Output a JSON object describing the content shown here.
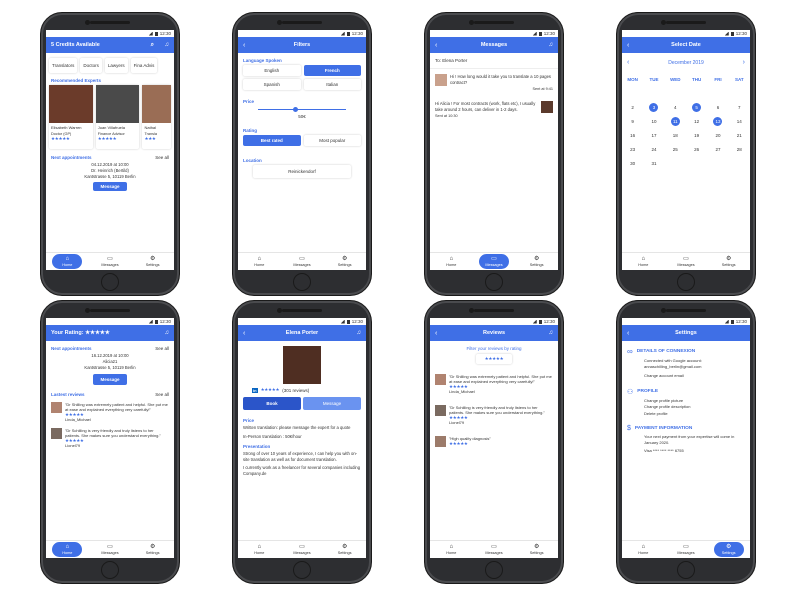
{
  "status": {
    "time": "12:30"
  },
  "tabbar": {
    "home": "Home",
    "messages": "Messages",
    "settings": "Settings"
  },
  "home": {
    "header": "5 Credits Available",
    "categories": [
      "Translators",
      "Doctors",
      "Lawyers",
      "Fina Advis"
    ],
    "recommended_title": "Recommended Experts",
    "experts": [
      {
        "name": "Elisabeth Warren",
        "role": "Doctor (GP)",
        "stars": "★★★★★"
      },
      {
        "name": "Juan Villafruela",
        "role": "Finance Advisor",
        "stars": "★★★★★"
      },
      {
        "name": "Nathal",
        "role": "Transla",
        "stars": "★★★"
      }
    ],
    "next_title": "Next appointments",
    "see_all": "See all",
    "appt_date": "04.12.2019 at 10:00",
    "appt_name": "Dr. Heinrich (Bertild)",
    "appt_addr": "Kantstrasse 5, 10119 Berlin",
    "message_btn": "Message"
  },
  "filters": {
    "header": "Filters",
    "lang_label": "Language Spoken",
    "langs": [
      "English",
      "French",
      "Spanish",
      "Italian"
    ],
    "price_label": "Price",
    "price_value": "50€",
    "rating_label": "Rating",
    "rating_opts": [
      "Best rated",
      "Most popular"
    ],
    "location_label": "Location",
    "location_value": "Reinickendorf"
  },
  "messages": {
    "header": "Messages",
    "to": "To: Elena Porter",
    "m1": "Hi ! How long would it take you to translate a 10 pages contract?",
    "m1_time": "Sent at 9:41",
    "m2": "Hi Alicia ! For most contracts (work, flats etc), I usually take around 2 hours, can deliver in 1-2 days.",
    "m2_time": "Sent at 10:30"
  },
  "calendar": {
    "header": "Select Date",
    "month": "December 2019",
    "days": [
      "MON",
      "TUE",
      "WED",
      "THU",
      "FRI",
      "SAT"
    ],
    "rows": [
      [
        "",
        "",
        "",
        "",
        "",
        ""
      ],
      [
        "2",
        "3",
        "4",
        "5",
        "6",
        "7"
      ],
      [
        "9",
        "10",
        "11",
        "12",
        "13",
        "14"
      ],
      [
        "16",
        "17",
        "18",
        "19",
        "20",
        "21"
      ],
      [
        "23",
        "24",
        "25",
        "26",
        "27",
        "28"
      ],
      [
        "30",
        "31",
        "",
        "",
        "",
        ""
      ]
    ],
    "selected": [
      "3",
      "5",
      "11",
      "13"
    ]
  },
  "profile_home": {
    "header": "Your Rating: ★★★★★",
    "next_title": "Next appointments",
    "see_all": "See all",
    "appt_date": "16.12.2019 at 10:00",
    "appt_name": "Alicia21",
    "appt_addr": "Kantstrasse 5, 10119 Berlin",
    "message_btn": "Message",
    "reviews_title": "Lastest reviews",
    "r1_text": "\"Dr Shilling was extremely patient and helpful. She put me at ease and explained everything very carefully!\"",
    "r1_stars": "★★★★★",
    "r1_name": "Linda_Michael",
    "r2_text": "\"Dr Schilling is very friendly and truly listens to her patients. She makes sure you understand everything.\"",
    "r2_stars": "★★★★★",
    "r2_name": "Lionel79"
  },
  "expert": {
    "header": "Elena Porter",
    "stars": "★★★★★",
    "reviews": "(301 reviews)",
    "book": "Book",
    "message": "Message",
    "price_label": "Price",
    "price1": "Written translation: please message the expert for a quote",
    "price2": "In-Person translation : 50€/hour",
    "pres_label": "Presentation",
    "pres1": "Strong of over 10 years of experience, I can help you with on-site translation as well as for document translation.",
    "pres2": "I currently work as a freelancer for several companies including Company.de"
  },
  "reviews": {
    "header": "Reviews",
    "filter": "Filter your reviews by rating",
    "stars": "★★★★★",
    "r1_text": "\"Dr Shilling was extremely patient and helpful. She put me at ease and explained everything very carefully!\"",
    "r1_stars": "★★★★★",
    "r1_name": "Linda_Michael",
    "r2_text": "\"Dr Schilling is very friendly and truly listens to her patients. She makes sure you understand everything.\"",
    "r2_stars": "★★★★★",
    "r2_name": "Lionel79",
    "r3_text": "\"High quality diagnosis\"",
    "r3_stars": "★★★★★"
  },
  "settings": {
    "header": "Settings",
    "s1_title": "DETAILS OF CONNEXION",
    "s1_a": "Connected with Google account: annaschilling_berlin@gmail.com",
    "s1_b": "Change account email",
    "s2_title": "PROFILE",
    "s2_a": "Change profile picture",
    "s2_b": "Change profile description",
    "s2_c": "Delete profile",
    "s3_title": "PAYMENT INFORMATION",
    "s3_a": "Your next payment from your expertise will come in January 2020.",
    "s3_b": "Visa **** **** **** 6755"
  }
}
